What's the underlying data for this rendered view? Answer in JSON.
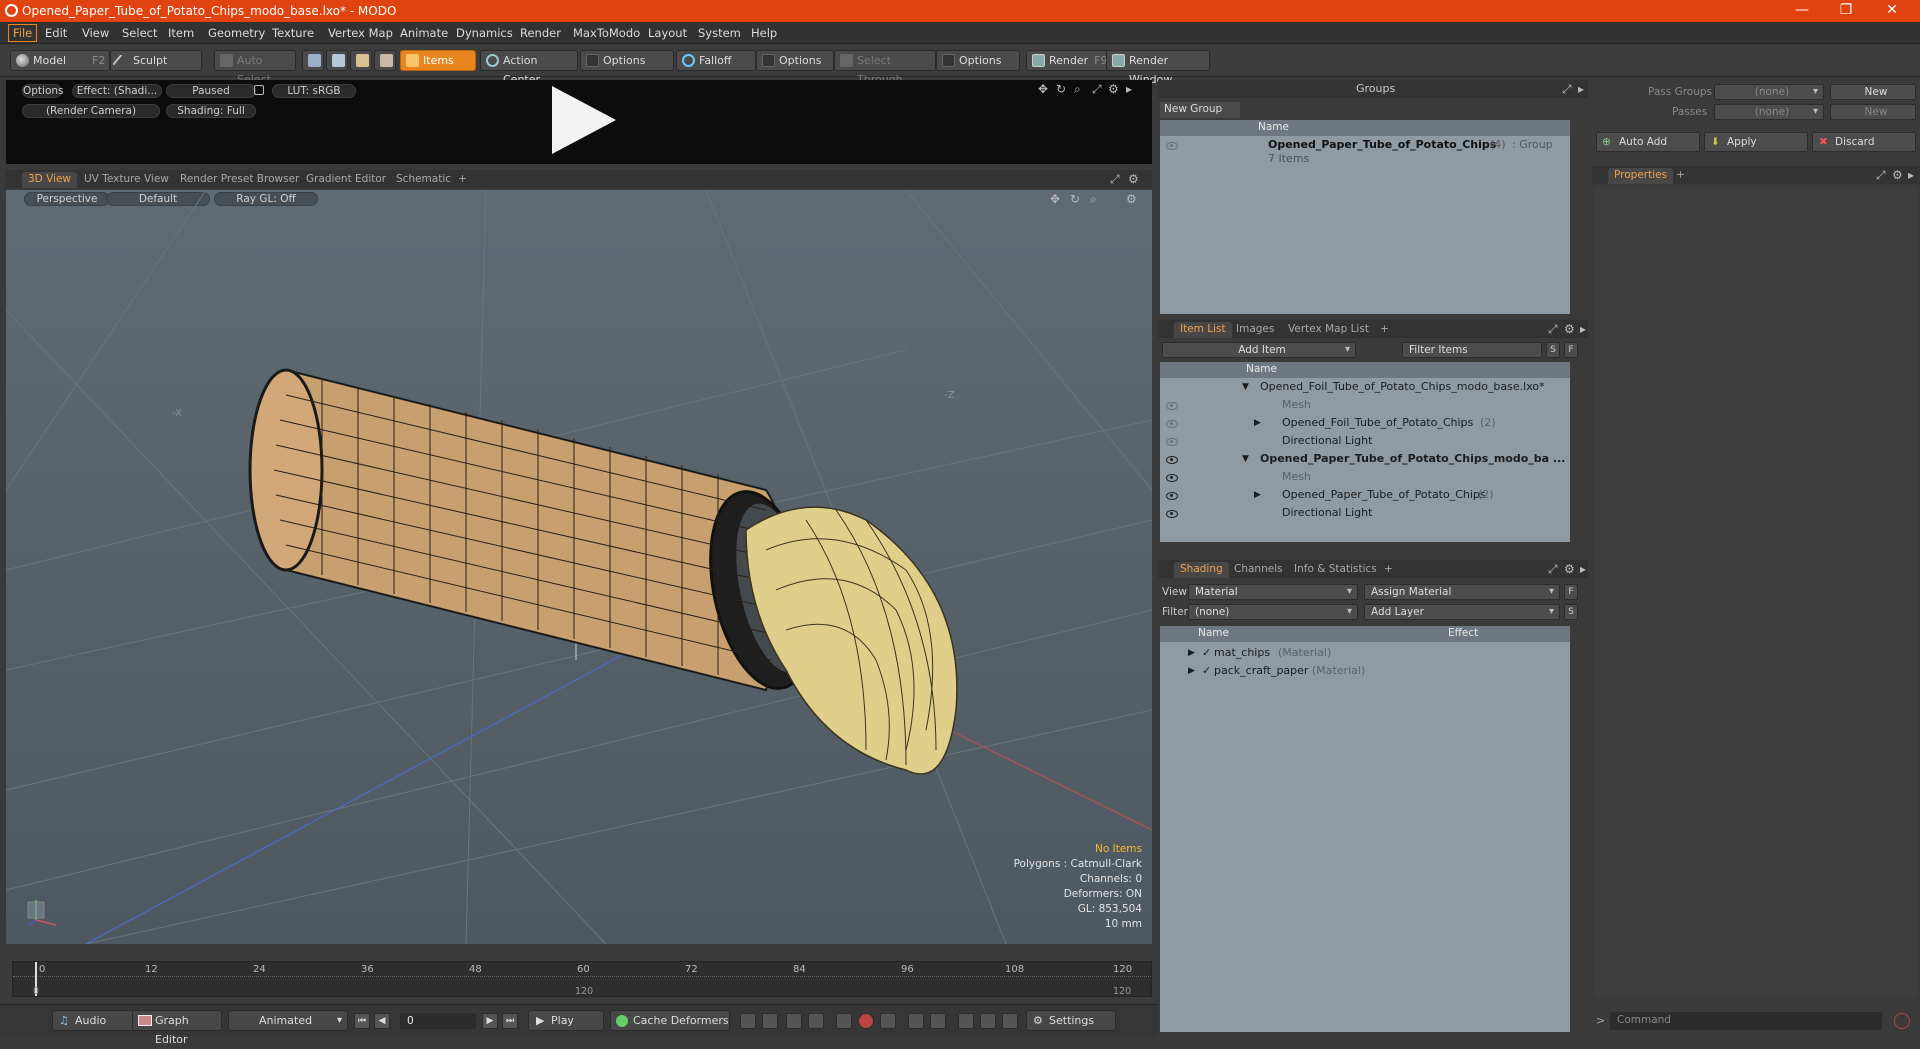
{
  "window": {
    "title": "Opened_Paper_Tube_of_Potato_Chips_modo_base.lxo* - MODO",
    "min": "—",
    "restore": "❐",
    "close": "✕"
  },
  "menu": [
    "File",
    "Edit",
    "View",
    "Select",
    "Item",
    "Geometry",
    "Texture",
    "Vertex Map",
    "Animate",
    "Dynamics",
    "Render",
    "MaxToModo",
    "Layout",
    "System",
    "Help"
  ],
  "toolbar": {
    "model": "Model",
    "model_key": "F2",
    "sculpt": "Sculpt",
    "auto_select": "Auto Select",
    "items": "Items",
    "action_center": "Action Center",
    "options1": "Options",
    "falloff": "Falloff",
    "options2": "Options",
    "select_through": "Select Through",
    "options3": "Options",
    "render": "Render",
    "render_key": "F9",
    "render_window": "Render Window"
  },
  "render_strip": {
    "options": "Options",
    "effect": "Effect: (Shadi...",
    "paused": "Paused",
    "lut": "LUT: sRGB",
    "camera": "(Render Camera)",
    "shading": "Shading: Full"
  },
  "view_tabs": [
    "3D View",
    "UV Texture View",
    "Render Preset Browser",
    "Gradient Editor",
    "Schematic",
    "+"
  ],
  "viewport": {
    "perspective": "Perspective",
    "default": "Default",
    "raygl": "Ray GL: Off",
    "axis_x": "-X",
    "axis_z": "-Z",
    "hud": {
      "no_items": "No Items",
      "polygons": "Polygons : Catmull-Clark",
      "channels": "Channels: 0",
      "deformers": "Deformers: ON",
      "gl": "GL: 853,504",
      "scale": "10 mm"
    }
  },
  "timeline": {
    "ticks": [
      "0",
      "12",
      "24",
      "36",
      "48",
      "60",
      "72",
      "84",
      "96",
      "108",
      "120"
    ],
    "start": "0",
    "mid": "120",
    "end": "120"
  },
  "bottombar": {
    "audio": "Audio",
    "graph_editor": "Graph Editor",
    "animated": "Animated",
    "frame": "0",
    "play": "Play",
    "cache_deformers": "Cache Deformers",
    "settings": "Settings"
  },
  "groups": {
    "title": "Groups",
    "new_group": "New Group",
    "col_name": "Name",
    "item_name": "Opened_Paper_Tube_of_Potato_Chips",
    "item_count": "(4)",
    "item_type": ": Group",
    "item_sub": "7 Items"
  },
  "item_list": {
    "tabs": [
      "Item List",
      "Images",
      "Vertex Map List",
      "+"
    ],
    "add_item": "Add Item",
    "filter": "Filter Items",
    "s": "S",
    "f": "F",
    "col_name": "Name",
    "rows": [
      {
        "label": "Opened_Foil_Tube_of_Potato_Chips_modo_base.lxo*",
        "extra": ""
      },
      {
        "label": "Mesh",
        "extra": ""
      },
      {
        "label": "Opened_Foil_Tube_of_Potato_Chips",
        "extra": "(2)"
      },
      {
        "label": "Directional Light",
        "extra": ""
      },
      {
        "label": "Opened_Paper_Tube_of_Potato_Chips_modo_ba ...",
        "extra": ""
      },
      {
        "label": "Mesh",
        "extra": ""
      },
      {
        "label": "Opened_Paper_Tube_of_Potato_Chips",
        "extra": "(2)"
      },
      {
        "label": "Directional Light",
        "extra": ""
      }
    ]
  },
  "shading": {
    "tabs": [
      "Shading",
      "Channels",
      "Info & Statistics",
      "+"
    ],
    "view_label": "View",
    "view_value": "Material",
    "assign": "Assign Material",
    "f": "F",
    "filter_label": "Filter",
    "filter_value": "(none)",
    "add_layer": "Add Layer",
    "s": "S",
    "col_name": "Name",
    "col_effect": "Effect",
    "rows": [
      {
        "label": "mat_chips",
        "type": "(Material)"
      },
      {
        "label": "pack_craft_paper",
        "type": "(Material)"
      }
    ]
  },
  "right": {
    "pass_groups": "Pass Groups",
    "passes": "Passes",
    "none": "(none)",
    "new": "New",
    "auto_add": "Auto Add",
    "apply": "Apply",
    "discard": "Discard",
    "properties": "Properties",
    "plus": "+",
    "command": "Command"
  }
}
